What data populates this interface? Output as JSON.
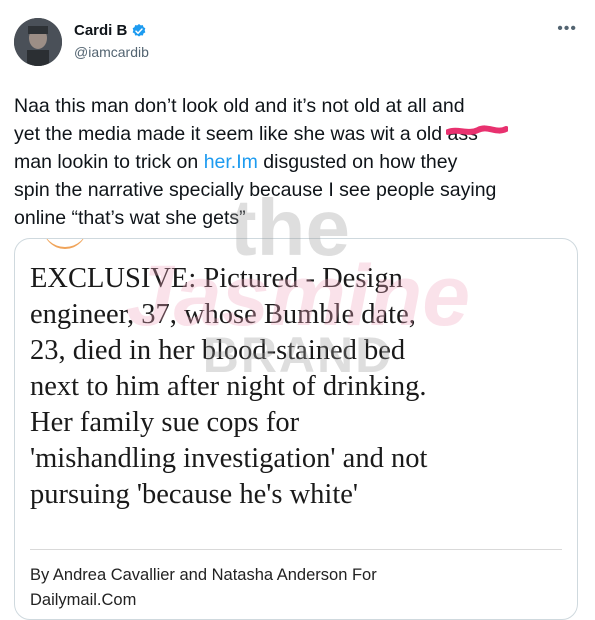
{
  "tweet": {
    "author_name": "Cardi B",
    "author_handle": "@iamcardib",
    "more_label": "•••",
    "text_lines": [
      "Naa this man don’t look old and it’s not old at all and",
      "yet the media made it seem like she was wit a old",
      "man lookin to trick on",
      " disgusted on how they",
      "spin the narrative specially because I see people saying",
      "online “that’s wat she gets”"
    ],
    "scribbled_word": "ass",
    "link_text": "her.Im"
  },
  "card": {
    "headline_lines": [
      "EXCLUSIVE: Pictured - Design",
      "engineer, 37, whose Bumble date,",
      "23, died in her blood-stained bed",
      "next to him after night of drinking.",
      "Her family sue cops for",
      "'mishandling investigation' and not",
      "pursuing 'because he's white'"
    ],
    "byline": "By Andrea Cavallier and Natasha Anderson For",
    "byline_cut": "Dailymail.Com"
  },
  "watermark": {
    "line1": "the",
    "line2": "Jasmine",
    "line3": "BRAND"
  },
  "colors": {
    "link": "#1d9bf0",
    "verified": "#1d9bf0",
    "scribble": "#e8316f",
    "handle": "#536471"
  }
}
